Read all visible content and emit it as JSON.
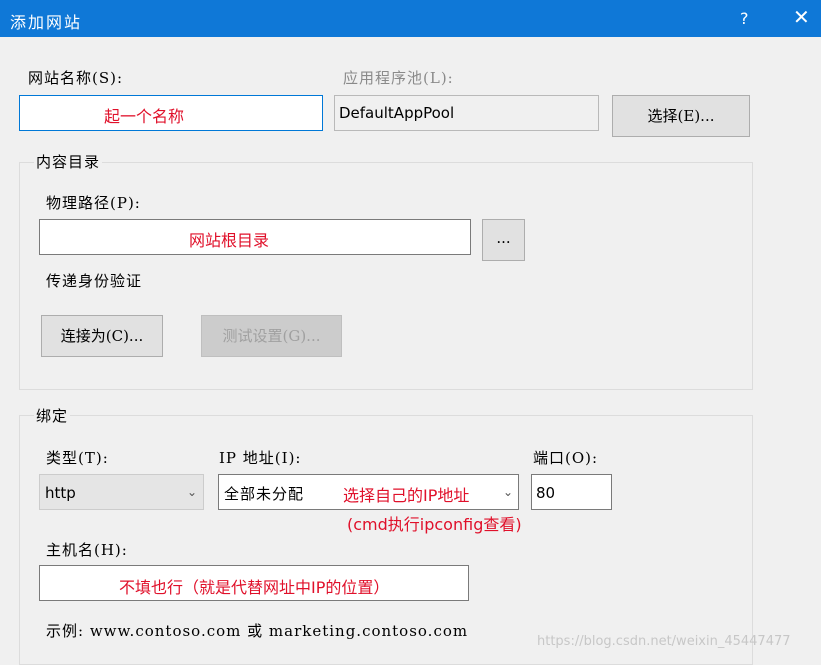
{
  "window": {
    "title": "添加网站",
    "help": "?",
    "close": "✕"
  },
  "site_name": {
    "label": "网站名称(S):",
    "value": "起一个名称"
  },
  "app_pool": {
    "label": "应用程序池(L):",
    "value": "DefaultAppPool",
    "select_button": "选择(E)..."
  },
  "content_dir": {
    "group_label": "内容目录",
    "physical_path_label": "物理路径(P):",
    "physical_path_value": "网站根目录",
    "browse_button": "...",
    "passthrough_label": "传递身份验证",
    "connect_as_button": "连接为(C)...",
    "test_settings_button": "测试设置(G)..."
  },
  "binding": {
    "group_label": "绑定",
    "type_label": "类型(T):",
    "type_value": "http",
    "ip_label": "IP 地址(I):",
    "ip_value": "全部未分配",
    "ip_note": "选择自己的IP地址",
    "ip_note2": "(cmd执行ipconfig查看)",
    "port_label": "端口(O):",
    "port_value": "80",
    "host_label": "主机名(H):",
    "host_value": "不填也行（就是代替网址中IP的位置）",
    "example": "示例: www.contoso.com 或 marketing.contoso.com"
  },
  "watermark": "https://blog.csdn.net/weixin_45447477",
  "colors": {
    "titlebar": "#0f78d7",
    "annotation": "#e0102a",
    "focus_border": "#0078d7"
  },
  "icons": {
    "dropdown": "chevron-down-icon",
    "close": "close-icon"
  }
}
